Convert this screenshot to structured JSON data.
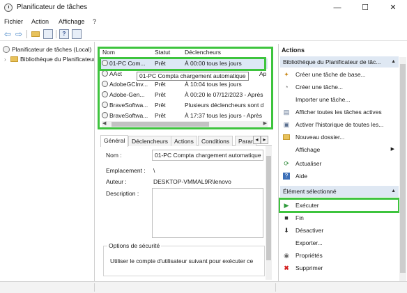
{
  "window": {
    "title": "Planificateur de tâches",
    "minimize": "—",
    "maximize": "☐",
    "close": "✕"
  },
  "menu": [
    "Fichier",
    "Action",
    "Affichage",
    "?"
  ],
  "toolbar": {
    "back": "⇦",
    "forward": "⇨",
    "help_glyph": "?"
  },
  "tree": {
    "root": "Planificateur de tâches (Local)",
    "library": "Bibliothèque du Planificateur"
  },
  "tasks": {
    "columns": [
      "Nom",
      "Statut",
      "Déclencheurs"
    ],
    "rows": [
      {
        "name": "01-PC Com...",
        "status": "Prêt",
        "trigger": "À 00:00 tous les jours"
      },
      {
        "name": "AAct",
        "status": "",
        "trigger": "Ap"
      },
      {
        "name": "AdobeGCInv...",
        "status": "Prêt",
        "trigger": "À 10:04 tous les jours"
      },
      {
        "name": "Adobe-Gen...",
        "status": "Prêt",
        "trigger": "À 00:20 le 07/12/2023 - Après"
      },
      {
        "name": "BraveSoftwa...",
        "status": "Prêt",
        "trigger": "Plusieurs déclencheurs sont d"
      },
      {
        "name": "BraveSoftwa...",
        "status": "Prêt",
        "trigger": "À 17:37 tous les jours - Après"
      }
    ],
    "tooltip": "01-PC Compta chargement automatique"
  },
  "details": {
    "tabs": [
      "Général",
      "Déclencheurs",
      "Actions",
      "Conditions",
      "Parar"
    ],
    "nom_label": "Nom :",
    "nom_value": "01-PC Compta chargement automatique",
    "emplacement_label": "Emplacement :",
    "emplacement_value": "\\",
    "auteur_label": "Auteur :",
    "auteur_value": "DESKTOP-VMMAL9R\\lenovo",
    "description_label": "Description :",
    "description_value": "",
    "security_title": "Options de sécurité",
    "security_text": "Utiliser le compte d'utilisateur suivant pour exécuter ce"
  },
  "actions": {
    "title": "Actions",
    "library_section": "Bibliothèque du Planificateur de tâc...",
    "library_items": [
      {
        "label": "Créer une tâche de base...",
        "icon": "create-basic-task-icon"
      },
      {
        "label": "Créer une tâche...",
        "icon": "create-task-icon"
      },
      {
        "label": "Importer une tâche...",
        "icon": ""
      },
      {
        "label": "Afficher toutes les tâches actives",
        "icon": "active-tasks-icon"
      },
      {
        "label": "Activer l'historique de toutes les...",
        "icon": "history-icon"
      },
      {
        "label": "Nouveau dossier...",
        "icon": "folder-icon"
      },
      {
        "label": "Affichage",
        "icon": ""
      },
      {
        "label": "Actualiser",
        "icon": "refresh-icon"
      },
      {
        "label": "Aide",
        "icon": "help-icon"
      }
    ],
    "selected_section": "Élément sélectionné",
    "selected_items": [
      {
        "label": "Exécuter",
        "icon": "run-icon"
      },
      {
        "label": "Fin",
        "icon": "end-icon"
      },
      {
        "label": "Désactiver",
        "icon": "disable-icon"
      },
      {
        "label": "Exporter...",
        "icon": ""
      },
      {
        "label": "Propriétés",
        "icon": "properties-icon"
      },
      {
        "label": "Supprimer",
        "icon": "delete-icon"
      }
    ]
  },
  "colors": {
    "highlight": "#3ec43e",
    "section_bg": "#dfe8f3",
    "accent": "#3c7fc4"
  }
}
